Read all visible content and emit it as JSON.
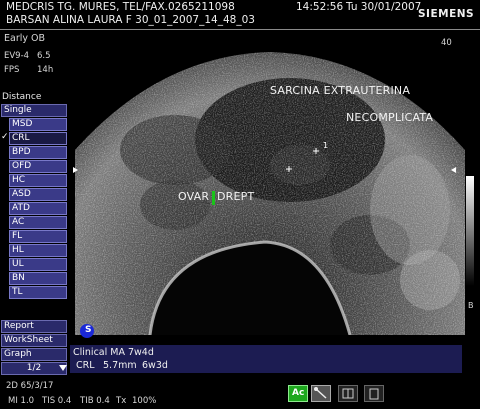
{
  "header": {
    "line1": "MEDCRIS TG. MURES, TEL/FAX.0265211098",
    "line2": "BARSAN ALINA LAURA F 30_01_2007_14_48_03",
    "time": "14:52:56",
    "date": "Tu 30/01/2007",
    "brand": "SIEMENS"
  },
  "info": {
    "mode": "Early OB",
    "probe_label": "EV9-4",
    "probe_value": "6.5",
    "fps_label": "FPS",
    "fps_value": "14h",
    "depth": "40"
  },
  "menu": {
    "title": "Distance",
    "single": "Single",
    "items": [
      "MSD",
      "CRL",
      "BPD",
      "OFD",
      "HC",
      "ASD",
      "ATD",
      "AC",
      "FL",
      "HL",
      "UL",
      "BN",
      "TL"
    ],
    "selected": "CRL",
    "bottom": [
      "Report",
      "WorkSheet",
      "Graph"
    ],
    "page": "1/2"
  },
  "annotations": {
    "title_line1": "SARCINA EXTRAUTERINA",
    "title_line2": "NECOMPLICATA",
    "ovar_left": "OVAR",
    "ovar_right": "DREPT",
    "caliper_num": "1",
    "side_marker": "B"
  },
  "results": {
    "clinical": "Clinical MA 7w4d",
    "crl_label": "CRL",
    "crl_value": "5.7mm",
    "crl_ga": "6w3d"
  },
  "footer": {
    "line1": "2D 65/3/17",
    "mi": "MI 1.0",
    "tis": "TIS 0.4",
    "tib": "TIB 0.4",
    "tx": "Tx",
    "tx_val": "100%"
  },
  "colors": {
    "menu_bg": "#2a2a6a",
    "results_bg": "#1c1c52",
    "ovar_marker": "#19c419"
  }
}
